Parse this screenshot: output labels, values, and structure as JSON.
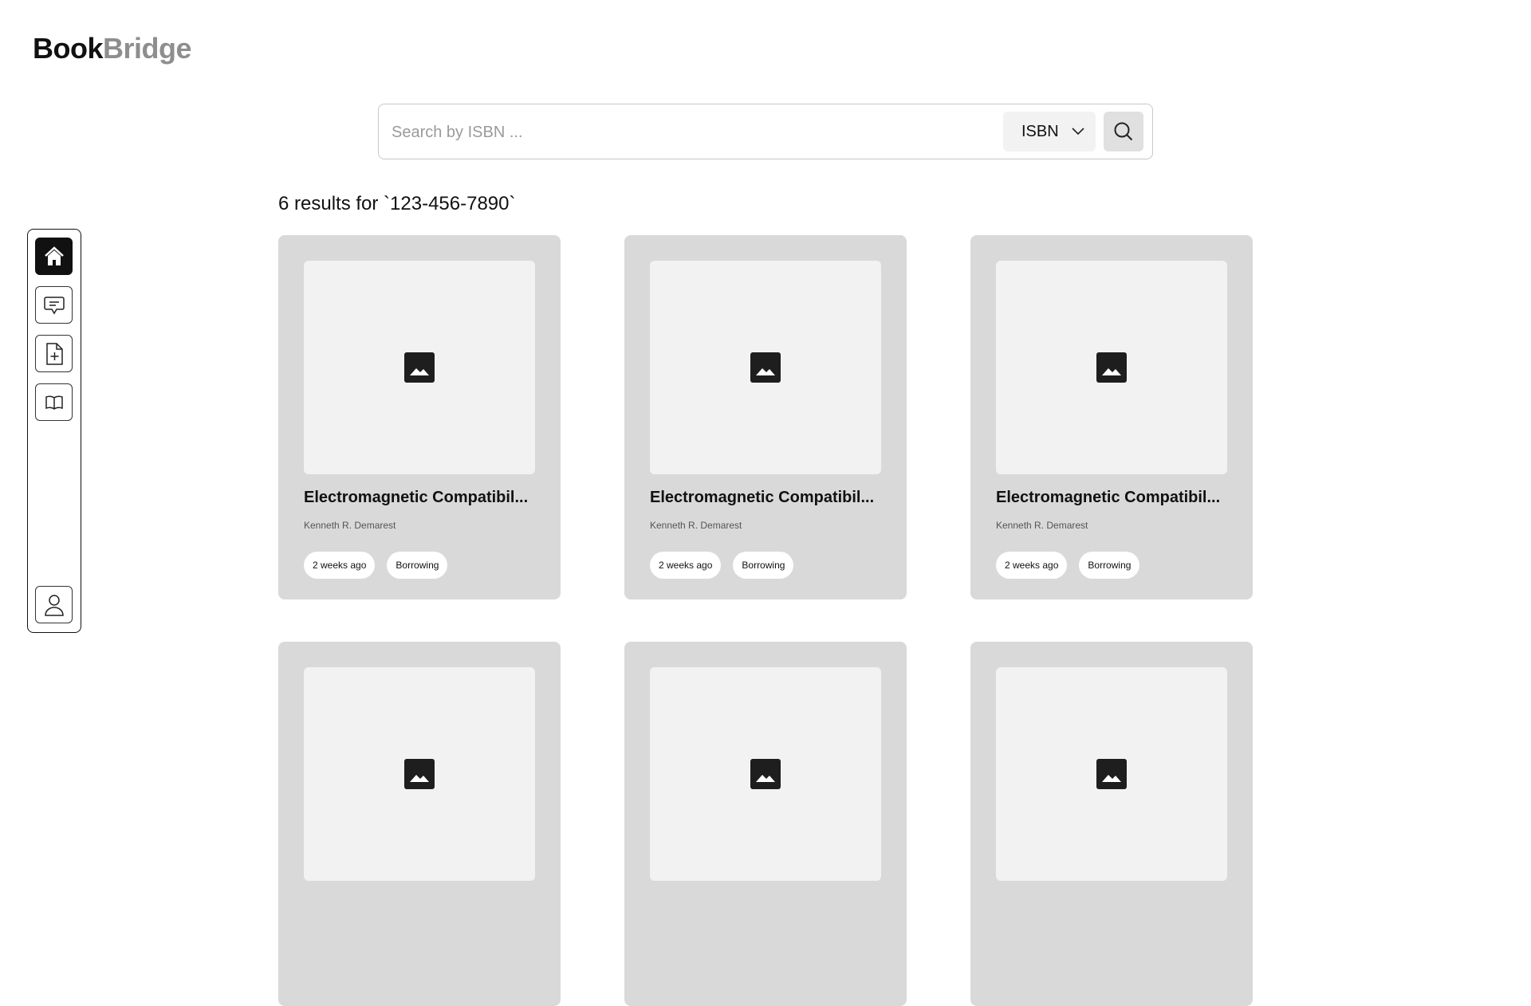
{
  "brand": {
    "part1": "Book",
    "part2": "Bridge"
  },
  "search": {
    "placeholder": "Search by ISBN ...",
    "value": "",
    "filter": "ISBN"
  },
  "results_text": "6 results for `123-456-7890`",
  "sidebar": {
    "items": [
      {
        "name": "home",
        "active": true
      },
      {
        "name": "messages"
      },
      {
        "name": "add-document"
      },
      {
        "name": "library"
      }
    ],
    "profile": "profile"
  },
  "books": [
    {
      "title": "Electromagnetic Compatibil...",
      "author": "Kenneth R. Demarest",
      "time": "2 weeks ago",
      "status": "Borrowing"
    },
    {
      "title": "Electromagnetic Compatibil...",
      "author": "Kenneth R. Demarest",
      "time": "2 weeks ago",
      "status": "Borrowing"
    },
    {
      "title": "Electromagnetic Compatibil...",
      "author": "Kenneth R. Demarest",
      "time": "2 weeks ago",
      "status": "Borrowing"
    },
    {
      "title": "",
      "author": "",
      "time": "",
      "status": ""
    },
    {
      "title": "",
      "author": "",
      "time": "",
      "status": ""
    },
    {
      "title": "",
      "author": "",
      "time": "",
      "status": ""
    }
  ]
}
